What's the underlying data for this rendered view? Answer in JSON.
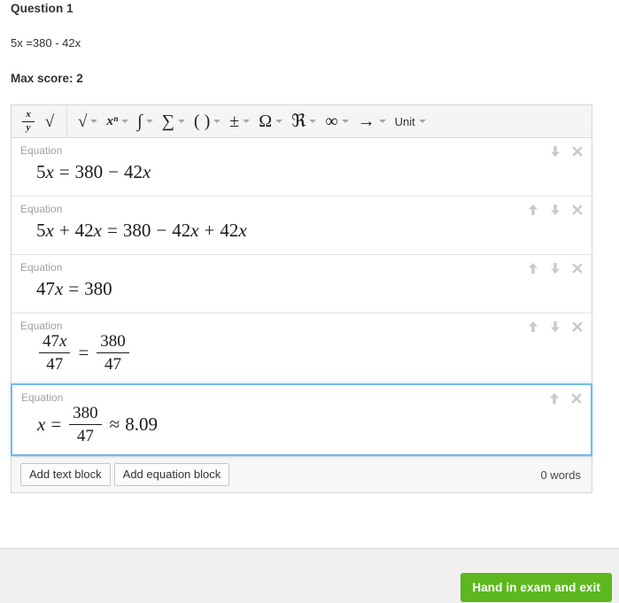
{
  "question": {
    "title": "Question 1",
    "text": "5x =380 - 42x",
    "max_score_label": "Max score: 2"
  },
  "toolbar": {
    "groups": [
      {
        "name": "basic",
        "items": [
          {
            "name": "fraction-button",
            "glyph": "x/y",
            "caret": false
          },
          {
            "name": "radical-button",
            "glyph": "√",
            "caret": false
          }
        ]
      },
      {
        "name": "math",
        "items": [
          {
            "name": "root-menu",
            "glyph": "√",
            "caret": true
          },
          {
            "name": "power-menu",
            "glyph": "xⁿ",
            "caret": true
          },
          {
            "name": "integral-menu",
            "glyph": "∫",
            "caret": true
          },
          {
            "name": "sum-menu",
            "glyph": "∑",
            "caret": true
          },
          {
            "name": "parentheses-menu",
            "glyph": "( )",
            "caret": true
          },
          {
            "name": "plusminus-menu",
            "glyph": "±",
            "caret": true
          },
          {
            "name": "omega-menu",
            "glyph": "Ω",
            "caret": true
          },
          {
            "name": "real-menu",
            "glyph": "ℜ",
            "caret": true
          },
          {
            "name": "infinity-menu",
            "glyph": "∞",
            "caret": true
          },
          {
            "name": "arrow-menu",
            "glyph": "→",
            "caret": true
          },
          {
            "name": "unit-menu",
            "glyph": "Unit",
            "caret": true
          }
        ]
      }
    ]
  },
  "blocks": [
    {
      "label": "Equation",
      "selected": false,
      "controls": [
        "down-arrow-icon",
        "close-icon"
      ],
      "equation": {
        "parts": [
          {
            "t": "num",
            "v": "5"
          },
          {
            "t": "it",
            "v": "x"
          },
          {
            "t": "op",
            "v": "="
          },
          {
            "t": "num",
            "v": "380"
          },
          {
            "t": "op",
            "v": "−"
          },
          {
            "t": "num",
            "v": "42"
          },
          {
            "t": "it",
            "v": "x"
          }
        ]
      }
    },
    {
      "label": "Equation",
      "selected": false,
      "controls": [
        "up-arrow-icon",
        "down-arrow-icon",
        "close-icon"
      ],
      "equation": {
        "parts": [
          {
            "t": "num",
            "v": "5"
          },
          {
            "t": "it",
            "v": "x"
          },
          {
            "t": "op",
            "v": "+"
          },
          {
            "t": "num",
            "v": "42"
          },
          {
            "t": "it",
            "v": "x"
          },
          {
            "t": "op",
            "v": "="
          },
          {
            "t": "num",
            "v": "380"
          },
          {
            "t": "op",
            "v": "−"
          },
          {
            "t": "num",
            "v": "42"
          },
          {
            "t": "it",
            "v": "x"
          },
          {
            "t": "op",
            "v": "+"
          },
          {
            "t": "num",
            "v": "42"
          },
          {
            "t": "it",
            "v": "x"
          }
        ]
      }
    },
    {
      "label": "Equation",
      "selected": false,
      "controls": [
        "up-arrow-icon",
        "down-arrow-icon",
        "close-icon"
      ],
      "equation": {
        "parts": [
          {
            "t": "num",
            "v": "47"
          },
          {
            "t": "it",
            "v": "x"
          },
          {
            "t": "op",
            "v": "="
          },
          {
            "t": "num",
            "v": "380"
          }
        ]
      }
    },
    {
      "label": "Equation",
      "selected": false,
      "controls": [
        "up-arrow-icon",
        "down-arrow-icon",
        "close-icon"
      ],
      "equation": {
        "parts": [
          {
            "t": "frac",
            "num": "47x",
            "den": "47",
            "num_italic_tail": true
          },
          {
            "t": "op",
            "v": "="
          },
          {
            "t": "frac",
            "num": "380",
            "den": "47"
          }
        ]
      }
    },
    {
      "label": "Equation",
      "selected": true,
      "controls": [
        "up-arrow-icon",
        "close-icon"
      ],
      "equation": {
        "parts": [
          {
            "t": "it",
            "v": "x"
          },
          {
            "t": "op",
            "v": "="
          },
          {
            "t": "frac",
            "num": "380",
            "den": "47"
          },
          {
            "t": "op",
            "v": "≈"
          },
          {
            "t": "num",
            "v": "8.09"
          }
        ]
      }
    }
  ],
  "editor_footer": {
    "add_text_block_label": "Add text block",
    "add_equation_block_label": "Add equation block",
    "word_count": "0 words"
  },
  "actions": {
    "hand_in_label": "Hand in exam and exit",
    "hand_in_color": "#5cb81d"
  }
}
